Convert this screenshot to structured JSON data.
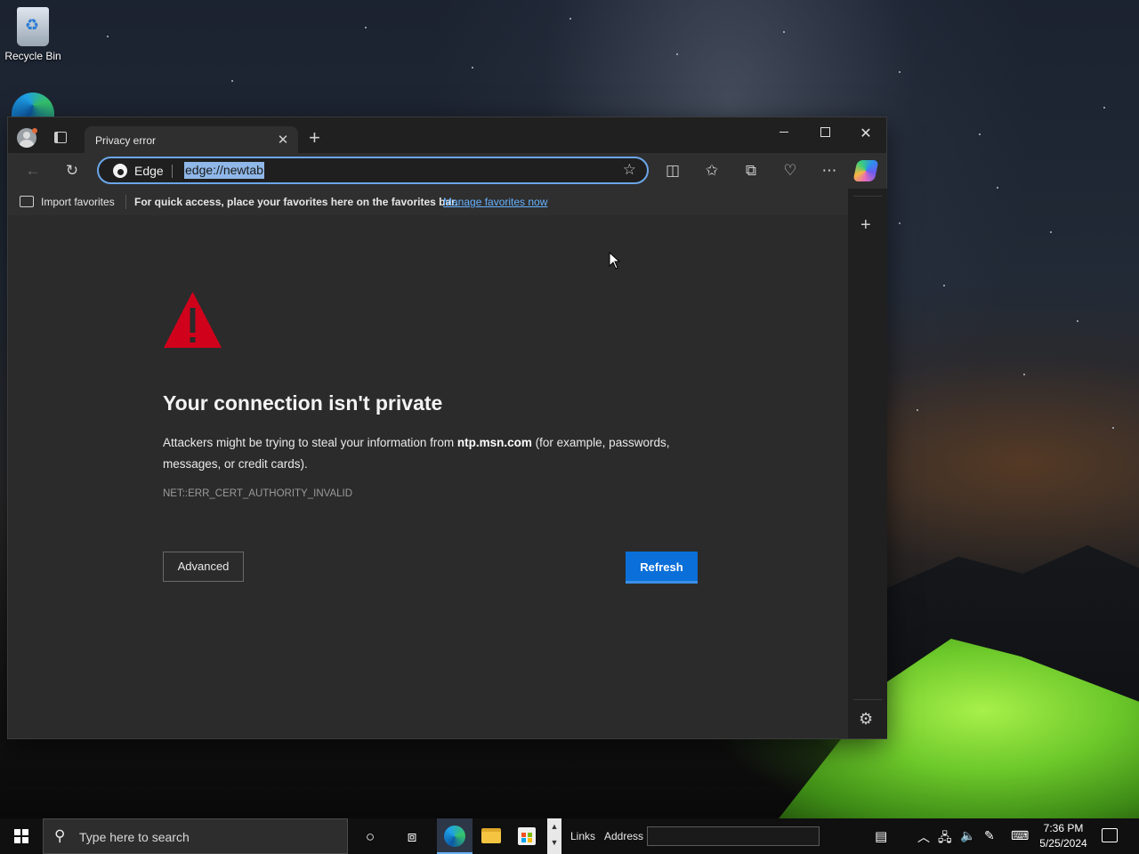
{
  "desktop": {
    "icons": [
      {
        "label": "Recycle Bin",
        "icon": "recycle-bin-icon"
      },
      {
        "label": "",
        "icon": "edge-desktop-icon"
      }
    ]
  },
  "browser": {
    "tab": {
      "title": "Privacy error",
      "close_icon": "close-icon"
    },
    "window_controls": {
      "minimize": "minimize-icon",
      "maximize": "maximize-icon",
      "close": "close-icon"
    },
    "toolbar": {
      "address": {
        "brand": "Edge",
        "url": "edge://newtab"
      },
      "icons": [
        "back-icon",
        "refresh-icon",
        "favorite-star-icon",
        "split-screen-icon",
        "favorites-icon",
        "collections-icon",
        "browser-essentials-icon",
        "more-icon",
        "copilot-icon"
      ]
    },
    "favorites_bar": {
      "import": "Import favorites",
      "message": "For quick access, place your favorites here on the favorites bar.",
      "link": "Manage favorites now"
    },
    "error_page": {
      "title": "Your connection isn't private",
      "description_pre": "Attackers might be trying to steal your information from ",
      "domain": "ntp.msn.com",
      "description_post": " (for example, passwords, messages, or credit cards).",
      "error_code": "NET::ERR_CERT_AUTHORITY_INVALID",
      "advanced_button": "Advanced",
      "refresh_button": "Refresh",
      "warning_color": "#d0021b"
    }
  },
  "taskbar": {
    "search_placeholder": "Type here to search",
    "links_label": "Links",
    "address_label": "Address",
    "time": "7:36 PM",
    "date": "5/25/2024"
  }
}
